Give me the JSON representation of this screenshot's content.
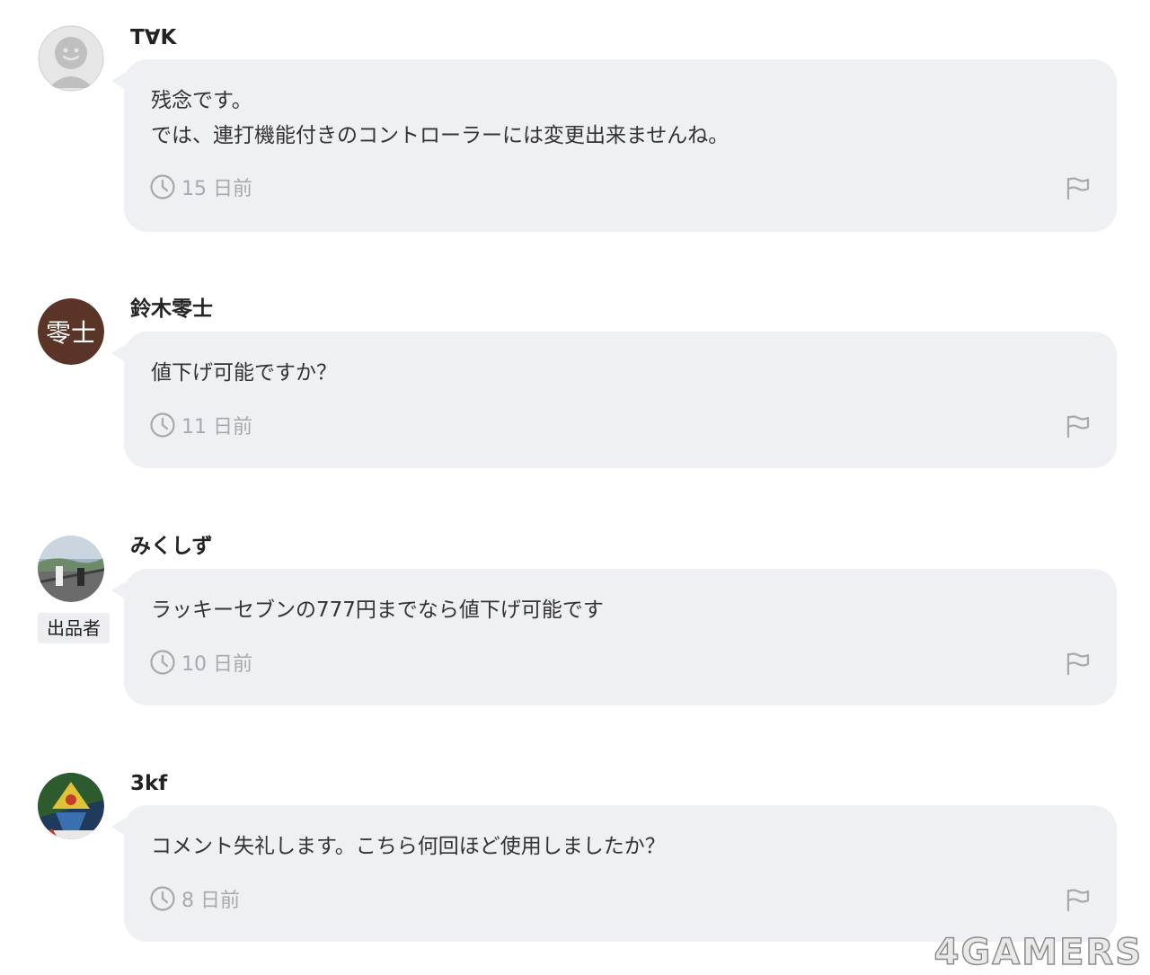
{
  "comments": [
    {
      "username": "T∀K",
      "lines": [
        "残念です。",
        "では、連打機能付きのコントローラーには変更出来ませんね。"
      ],
      "time": "15 日前",
      "avatar": "default-face-icon"
    },
    {
      "username": "鈴木零士",
      "lines": [
        "値下げ可能ですか？"
      ],
      "time": "11 日前",
      "avatar_text": "零士",
      "avatar_color": "#5a3426"
    },
    {
      "username": "みくしず",
      "lines": [
        "ラッキーセブンの777円までなら値下げ可能です"
      ],
      "time": "10 日前",
      "badge": "出品者",
      "avatar": "photo-avatar"
    },
    {
      "username": "3kf",
      "lines": [
        "コメント失礼します。こちら何回ほど使用しましたか？"
      ],
      "time": "8 日前",
      "avatar": "photo-avatar"
    }
  ],
  "watermark": "4GAMERS",
  "colors": {
    "bubble": "#eff0f4",
    "meta": "#a8a9ad",
    "text": "#333333"
  }
}
